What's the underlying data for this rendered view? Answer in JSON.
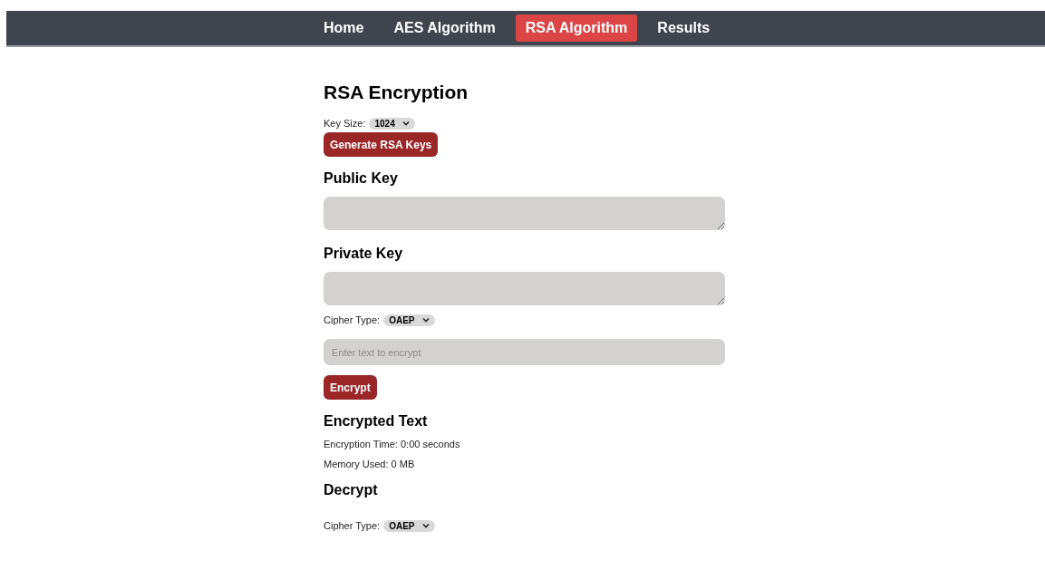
{
  "nav": [
    {
      "label": "Home",
      "selected": false
    },
    {
      "label": "AES Algorithm",
      "selected": false
    },
    {
      "label": "RSA Algorithm",
      "selected": true
    },
    {
      "label": "Results",
      "selected": false
    }
  ],
  "title": "RSA Encryption",
  "key_size": {
    "label": "Key Size:",
    "value": "1024"
  },
  "generate_button": "Generate RSA Keys",
  "public_key": {
    "heading": "Public Key"
  },
  "private_key": {
    "heading": "Private Key"
  },
  "cipher_type": {
    "label": "Cipher Type:",
    "value": "OAEP"
  },
  "plaintext": {
    "placeholder": "Enter text to encrypt"
  },
  "encrypt_button": "Encrypt",
  "encrypted": {
    "heading": "Encrypted Text",
    "time": "Encryption Time: 0:00 seconds",
    "memory": "Memory Used: 0 MB"
  },
  "decrypt": {
    "heading": "Decrypt",
    "cipher_type": {
      "label": "Cipher Type:",
      "value": "OAEP"
    }
  }
}
